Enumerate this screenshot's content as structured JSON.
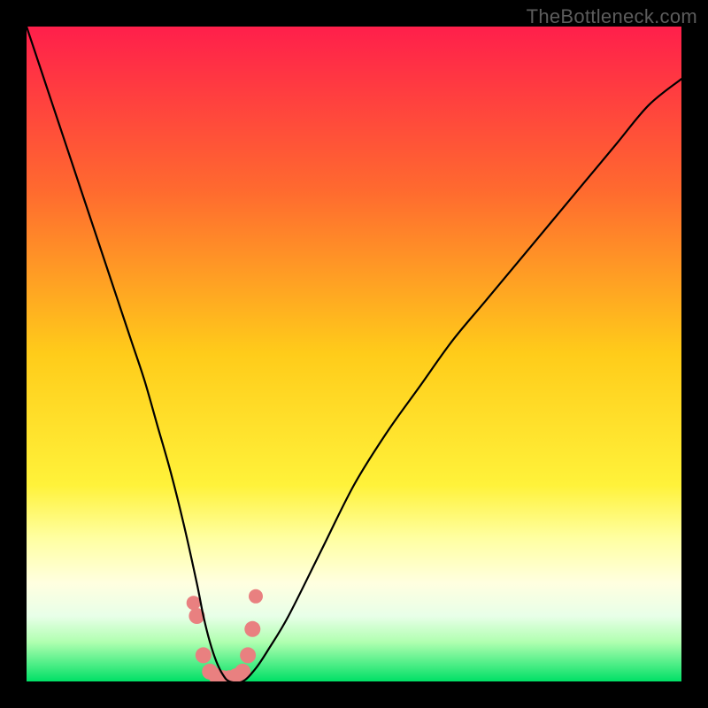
{
  "watermark": "TheBottleneck.com",
  "chart_data": {
    "type": "line",
    "title": "",
    "xlabel": "",
    "ylabel": "",
    "xlim": [
      0,
      100
    ],
    "ylim": [
      0,
      100
    ],
    "grid": false,
    "legend": false,
    "gradient_stops": [
      {
        "offset": 0,
        "color": "#ff1f4b"
      },
      {
        "offset": 0.25,
        "color": "#ff6a2f"
      },
      {
        "offset": 0.5,
        "color": "#ffcc1a"
      },
      {
        "offset": 0.7,
        "color": "#fff23a"
      },
      {
        "offset": 0.78,
        "color": "#ffffa0"
      },
      {
        "offset": 0.85,
        "color": "#ffffe0"
      },
      {
        "offset": 0.9,
        "color": "#e8ffe8"
      },
      {
        "offset": 0.94,
        "color": "#b0ffb0"
      },
      {
        "offset": 1.0,
        "color": "#00e066"
      }
    ],
    "series": [
      {
        "name": "bottleneck-curve",
        "x": [
          0,
          2,
          4,
          6,
          8,
          10,
          12,
          14,
          16,
          18,
          20,
          22,
          24,
          26,
          27,
          28,
          29,
          30,
          31,
          33,
          35,
          37,
          40,
          45,
          50,
          55,
          60,
          65,
          70,
          75,
          80,
          85,
          90,
          95,
          100
        ],
        "values": [
          100,
          94,
          88,
          82,
          76,
          70,
          64,
          58,
          52,
          46,
          39,
          32,
          24,
          15,
          10,
          6,
          3,
          1,
          0,
          0,
          2,
          5,
          10,
          20,
          30,
          38,
          45,
          52,
          58,
          64,
          70,
          76,
          82,
          88,
          92
        ]
      }
    ],
    "valley_markers": {
      "name": "valley-dots",
      "color": "#e98080",
      "x": [
        25.5,
        26.0,
        27.0,
        28.0,
        29.0,
        30.0,
        31.0,
        32.0,
        33.0,
        33.8,
        34.5,
        35.0
      ],
      "values": [
        12.0,
        10.0,
        4.0,
        1.5,
        0.8,
        0.5,
        0.5,
        0.8,
        1.5,
        4.0,
        8.0,
        13.0
      ]
    }
  }
}
